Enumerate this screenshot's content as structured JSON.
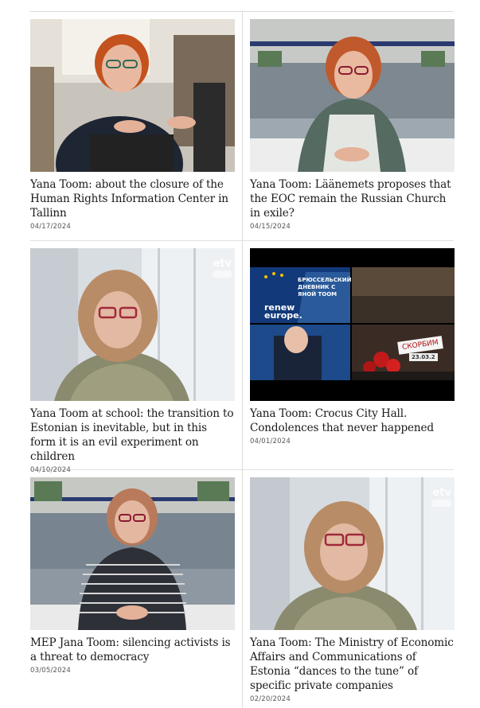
{
  "articles": [
    {
      "title": "Yana Toom: about the closure of the Human Rights Information Center in Tallinn",
      "date": "04/17/2024",
      "thumbnail": "woman-red-hair-studio-laptop"
    },
    {
      "title": "Yana Toom: Läänemets proposes that the EOC remain the Russian Church in exile?",
      "date": "04/15/2024",
      "thumbnail": "woman-red-hair-studio-desk"
    },
    {
      "title": "Yana Toom at school: the transition to Estonian is inevitable, but in this form it is an evil experiment on children",
      "date": "04/10/2024",
      "thumbnail": "woman-interview-window",
      "overlay": "etv"
    },
    {
      "title": "Yana Toom: Crocus City Hall. Condolences that never happened",
      "date": "04/01/2024",
      "thumbnail": "news-collage",
      "overlay_texts": [
        "БРЮССЕЛЬСКИЙ ДНЕВНИК С ЯНОЙ ТООМ",
        "renew europe.",
        "СКОРБИМ",
        "23.03.2"
      ]
    },
    {
      "title": "MEP Jana Toom: silencing activists is a threat to democracy",
      "date": "03/05/2024",
      "thumbnail": "woman-striped-sweater-studio"
    },
    {
      "title": "Yana Toom: The Ministry of Economic Affairs and Communications of Estonia “dances to the tune” of specific private companies",
      "date": "02/20/2024",
      "thumbnail": "woman-interview-window",
      "overlay": "etv"
    }
  ],
  "colors": {
    "hair": "#b8502a",
    "text": "#1a1a1a",
    "rule": "#dcdcdc"
  }
}
